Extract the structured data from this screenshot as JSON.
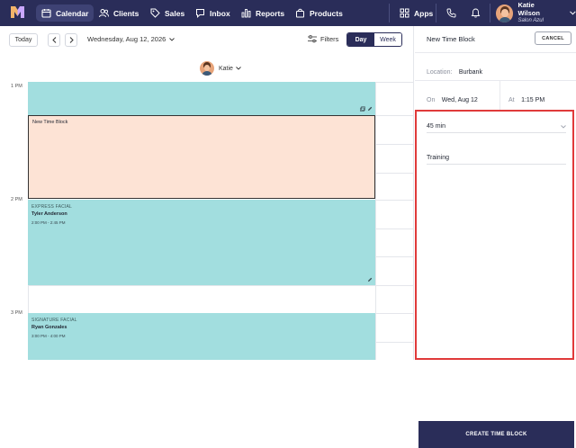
{
  "nav": {
    "items": [
      {
        "label": "Calendar",
        "icon": "calendar-icon",
        "active": true
      },
      {
        "label": "Clients",
        "icon": "clients-icon",
        "active": false
      },
      {
        "label": "Sales",
        "icon": "tag-icon",
        "active": false
      },
      {
        "label": "Inbox",
        "icon": "inbox-icon",
        "active": false
      },
      {
        "label": "Reports",
        "icon": "bar-chart-icon",
        "active": false
      },
      {
        "label": "Products",
        "icon": "bag-icon",
        "active": false
      }
    ],
    "apps_label": "Apps",
    "user_name": "Katie Wilson",
    "user_salon": "Salon Azul"
  },
  "toolbar": {
    "today_label": "Today",
    "date": "Wednesday, Aug 12, 2026",
    "filters_label": "Filters",
    "view_day": "Day",
    "view_week": "Week"
  },
  "staff": {
    "name": "Katie"
  },
  "calendar": {
    "hours": [
      "1 PM",
      "2 PM",
      "3 PM"
    ],
    "time_block_title": "New Time Block",
    "appointments": [
      {
        "service": "EXPRESS FACIAL",
        "client": "Tyler Anderson",
        "time": "2:00 PM - 2:45 PM"
      },
      {
        "service": "SIGNATURE FACIAL",
        "client": "Ryan Gonzales",
        "time": "3:00 PM - 4:00 PM"
      }
    ]
  },
  "panel": {
    "title": "New Time Block",
    "cancel_label": "CANCEL",
    "location_label": "Location:",
    "location_value": "Burbank",
    "on_label": "On",
    "on_value": "Wed, Aug 12",
    "at_label": "At",
    "at_value": "1:15 PM",
    "duration_value": "45 min",
    "reason_value": "Training",
    "create_label": "CREATE TIME BLOCK"
  },
  "colors": {
    "nav_bg": "#2a2d59",
    "appointment": "#a2dedf",
    "time_block": "#fde3d5",
    "highlight": "#e03a3a"
  }
}
